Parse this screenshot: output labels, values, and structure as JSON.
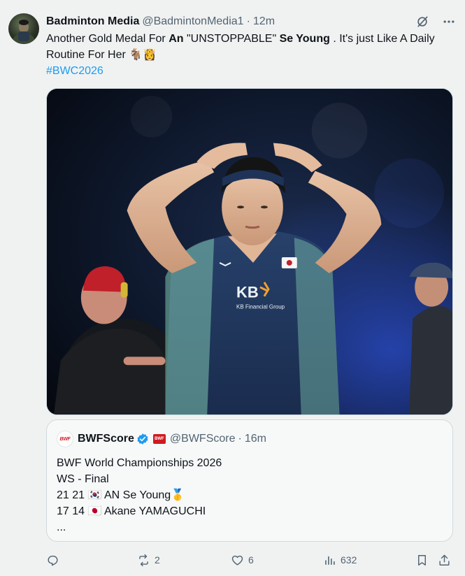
{
  "post": {
    "author_name": "Badminton Media",
    "author_handle": "@BadmintonMedia1",
    "separator": "·",
    "time": "12m",
    "text": {
      "t1": "Another Gold Medal For ",
      "b1": "An",
      "t2": " \"UNSTOPPABLE\" ",
      "b2": "Se Young",
      "t3": " . It's just Like A Daily Routine For Her 🐐👸",
      "hashtag": "#BWC2026"
    }
  },
  "media": {
    "jersey_brand": "KB",
    "jersey_sub": "KB Financial Group"
  },
  "quote": {
    "avatar_text": "BWF",
    "affiliate_text": "BWF",
    "author_name": "BWFScore",
    "author_handle": "@BWFScore",
    "separator": "·",
    "time": "16m",
    "lines": [
      "BWF World Championships 2026",
      "WS - Final",
      "21 21 🇰🇷 AN Se Young🥇",
      "17 14 🇯🇵 Akane YAMAGUCHI",
      "..."
    ]
  },
  "actions": {
    "reply_count": "",
    "repost_count": "2",
    "like_count": "6",
    "views_count": "632"
  },
  "colors": {
    "link": "#1d9bf0",
    "secondary_text": "#536471",
    "verified": "#1d9bf0",
    "background": "#f0f2f2"
  },
  "icons": {
    "grok": "grok-icon",
    "more": "more-icon",
    "reply": "reply-icon",
    "repost": "repost-icon",
    "like": "like-icon",
    "views": "views-icon",
    "bookmark": "bookmark-icon",
    "share": "share-icon",
    "verified": "verified-badge-icon"
  }
}
